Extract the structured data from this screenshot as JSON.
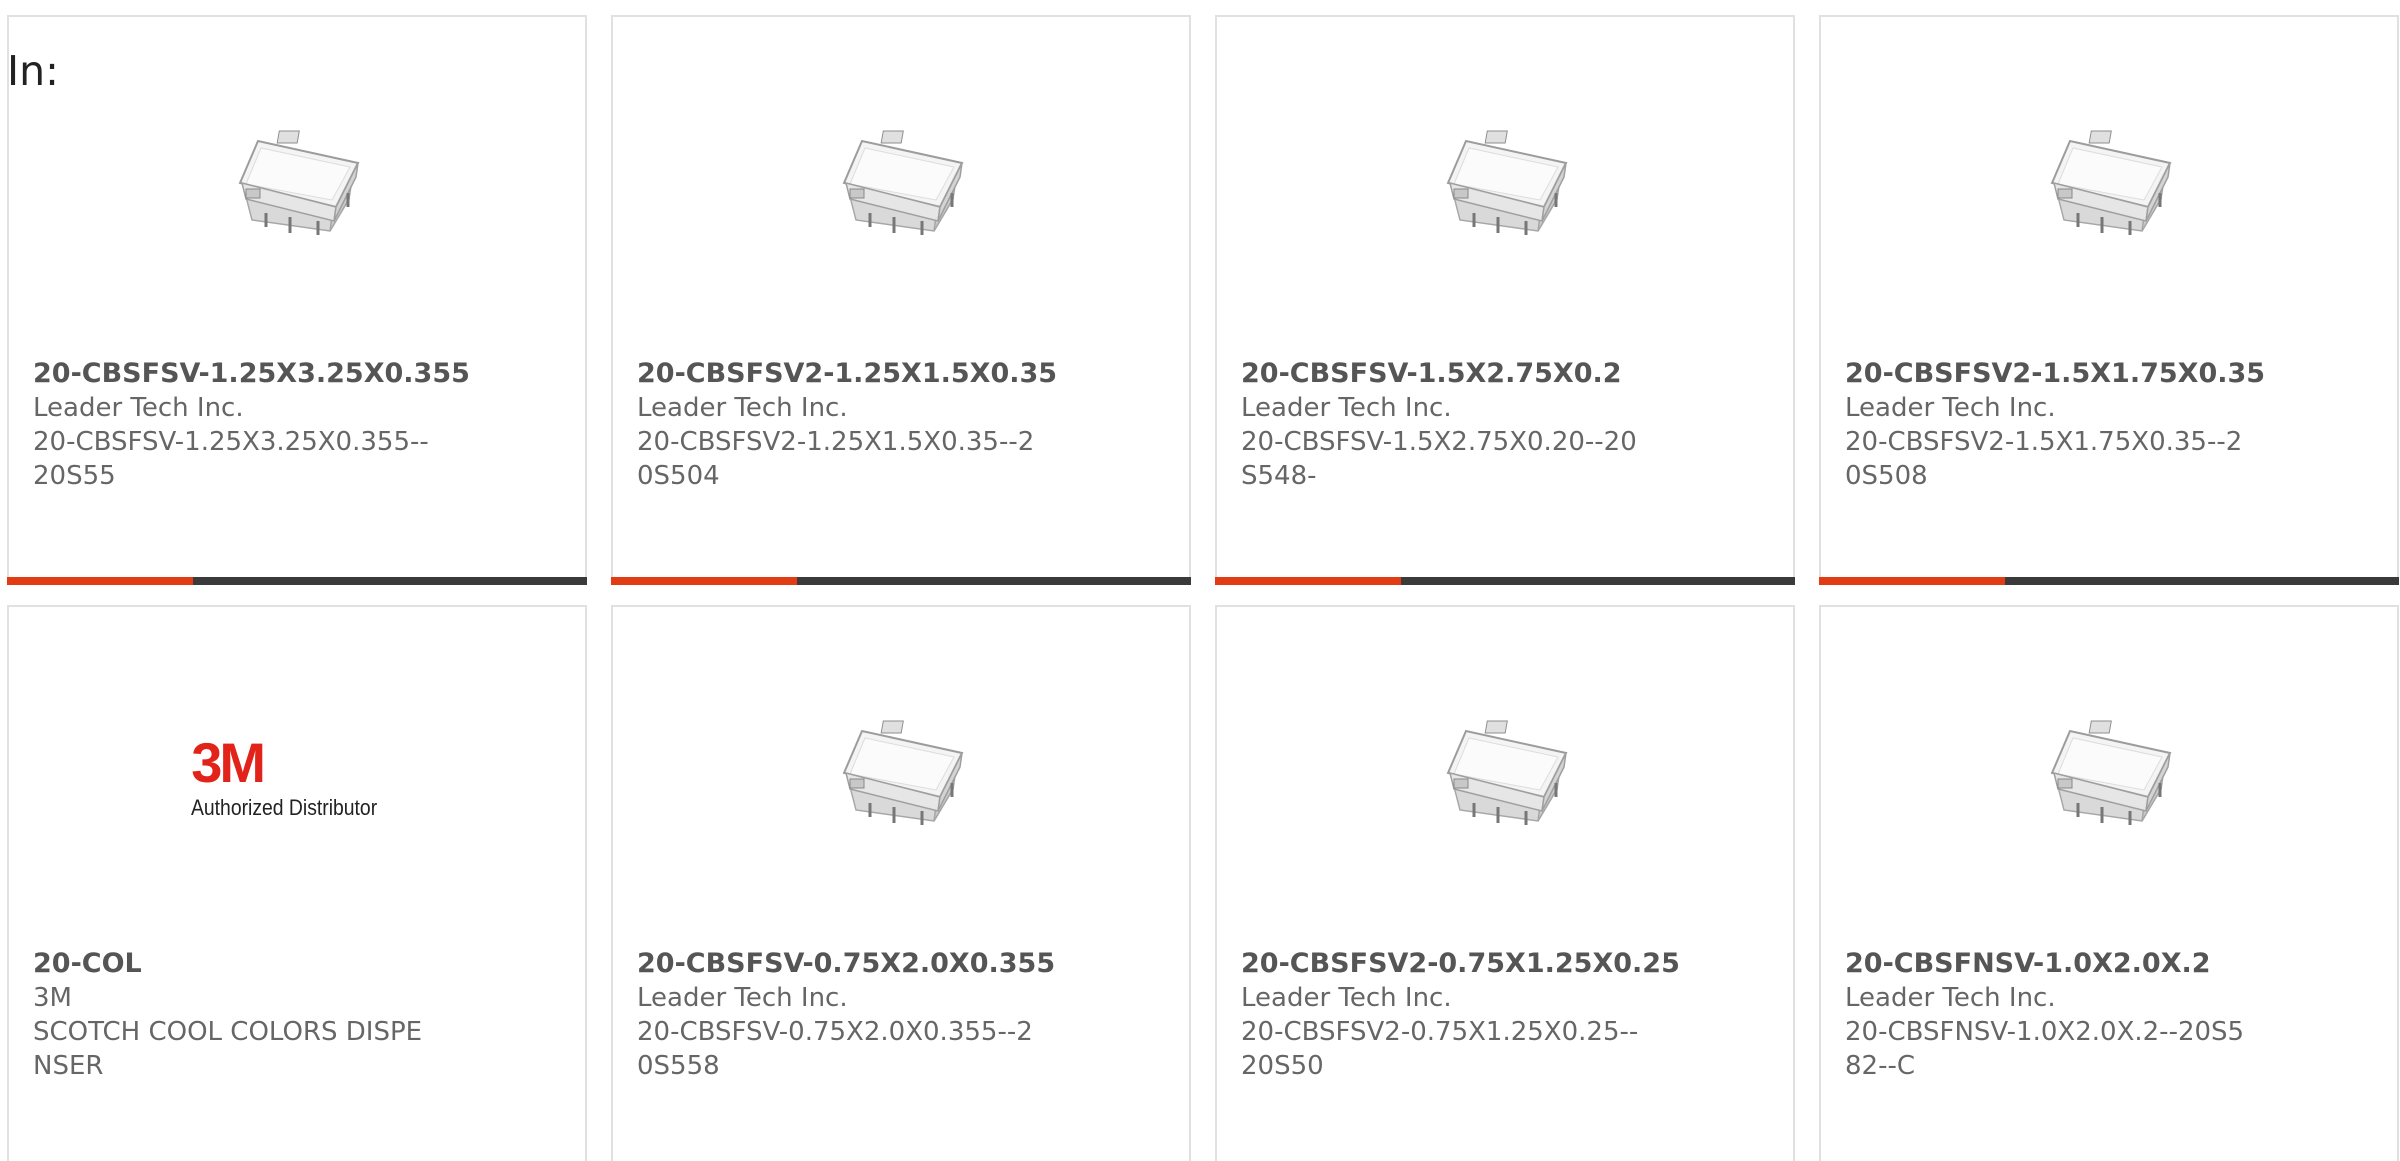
{
  "header": {
    "in_label": "In:"
  },
  "accent_color": "#e23c15",
  "progress_track_color": "#3a3a3a",
  "products": [
    {
      "image": "rf-shield-can-icon",
      "part_number": "20-CBSFSV-1.25X3.25X0.355",
      "manufacturer": "Leader Tech Inc.",
      "description": "20-CBSFSV-1.25X3.25X0.355--20S55",
      "progress": 0.32
    },
    {
      "image": "rf-shield-can-icon",
      "part_number": "20-CBSFSV2-1.25X1.5X0.35",
      "manufacturer": "Leader Tech Inc.",
      "description": "20-CBSFSV2-1.25X1.5X0.35--20S504",
      "progress": 0.32
    },
    {
      "image": "rf-shield-can-icon",
      "part_number": "20-CBSFSV-1.5X2.75X0.2",
      "manufacturer": "Leader Tech Inc.",
      "description": "20-CBSFSV-1.5X2.75X0.20--20S548-",
      "progress": 0.32
    },
    {
      "image": "rf-shield-can-icon",
      "part_number": "20-CBSFSV2-1.5X1.75X0.35",
      "manufacturer": "Leader Tech Inc.",
      "description": "20-CBSFSV2-1.5X1.75X0.35--20S508",
      "progress": 0.32
    },
    {
      "image": "3m-logo",
      "logo_mark": "3M",
      "logo_text": "Authorized Distributor",
      "part_number": "20-COL",
      "manufacturer": "3M",
      "description": "SCOTCH COOL COLORS DISPENSER",
      "progress": null
    },
    {
      "image": "rf-shield-can-icon",
      "part_number": "20-CBSFSV-0.75X2.0X0.355",
      "manufacturer": "Leader Tech Inc.",
      "description": "20-CBSFSV-0.75X2.0X0.355--20S558",
      "progress": null
    },
    {
      "image": "rf-shield-can-icon",
      "part_number": "20-CBSFSV2-0.75X1.25X0.25",
      "manufacturer": "Leader Tech Inc.",
      "description": "20-CBSFSV2-0.75X1.25X0.25--20S50",
      "progress": null
    },
    {
      "image": "rf-shield-can-icon",
      "part_number": "20-CBSFNSV-1.0X2.0X.2",
      "manufacturer": "Leader Tech Inc.",
      "description": "20-CBSFNSV-1.0X2.0X.2--20S582--C",
      "progress": null
    }
  ]
}
